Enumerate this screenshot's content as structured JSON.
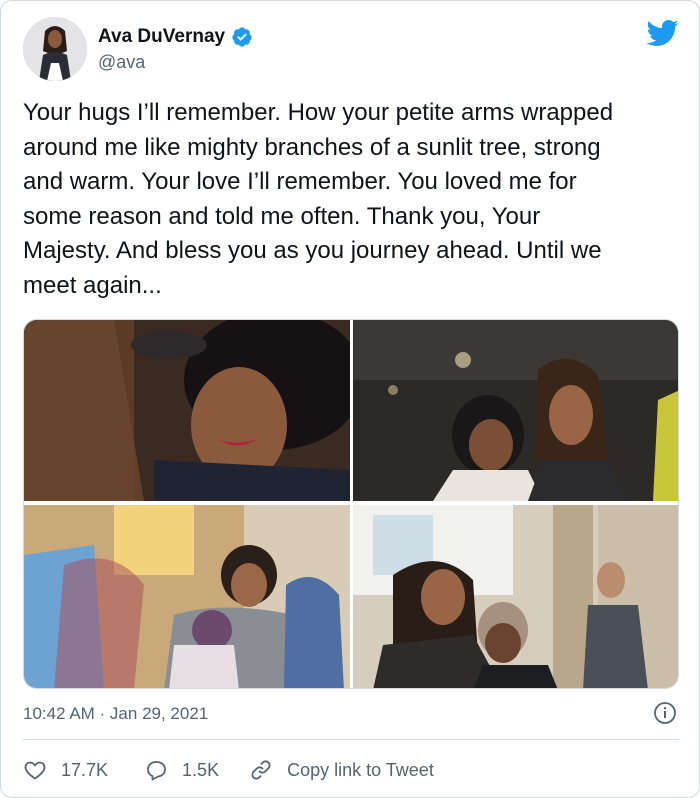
{
  "author": {
    "display_name": "Ava DuVernay",
    "handle": "@ava",
    "verified": true,
    "avatar_icon": "profile-photo"
  },
  "platform_icon": "twitter-bird-icon",
  "tweet": {
    "text": "Your hugs I’ll remember. How your petite arms wrapped\naround me like mighty branches of a sunlit tree, strong\nand warm. Your love I’ll remember. You loved me for\nsome reason and told me often. Thank you, Your\nMajesty. And bless you as you journey ahead. Until we\nmeet again..."
  },
  "media": {
    "count": 4
  },
  "meta": {
    "timestamp": "10:42 AM · Jan 29, 2021"
  },
  "actions": {
    "likes": "17.7K",
    "replies": "1.5K",
    "copy_link": "Copy link to Tweet"
  },
  "colors": {
    "accent": "#1d9bf0",
    "text_primary": "#0f1419",
    "text_secondary": "#536471",
    "border": "#cfd9de"
  }
}
